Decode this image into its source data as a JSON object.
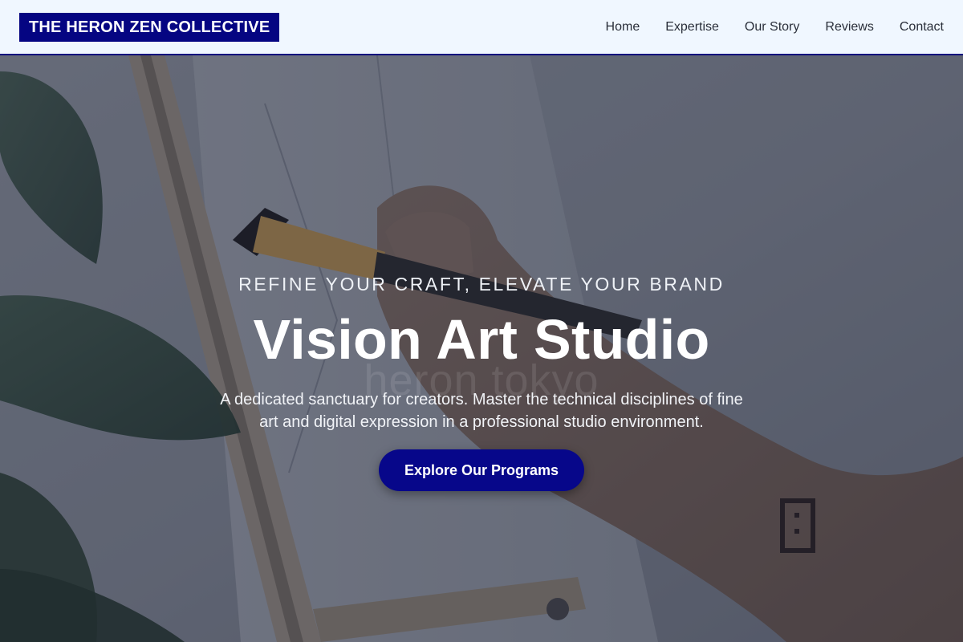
{
  "header": {
    "logo_text": "THE HERON ZEN COLLECTIVE",
    "nav": [
      "Home",
      "Expertise",
      "Our Story",
      "Reviews",
      "Contact"
    ]
  },
  "hero": {
    "kicker": "REFINE YOUR CRAFT, ELEVATE YOUR BRAND",
    "title": "Vision Art Studio",
    "watermark": "heron tokyo",
    "description": "A dedicated sanctuary for creators. Master the technical disciplines of fine art and digital expression in a professional studio environment.",
    "cta_label": "Explore Our Programs"
  },
  "colors": {
    "header_bg": "#f0f7ff",
    "brand_navy": "#050582",
    "cta_bg": "#07078a",
    "text_light": "#ffffff"
  }
}
